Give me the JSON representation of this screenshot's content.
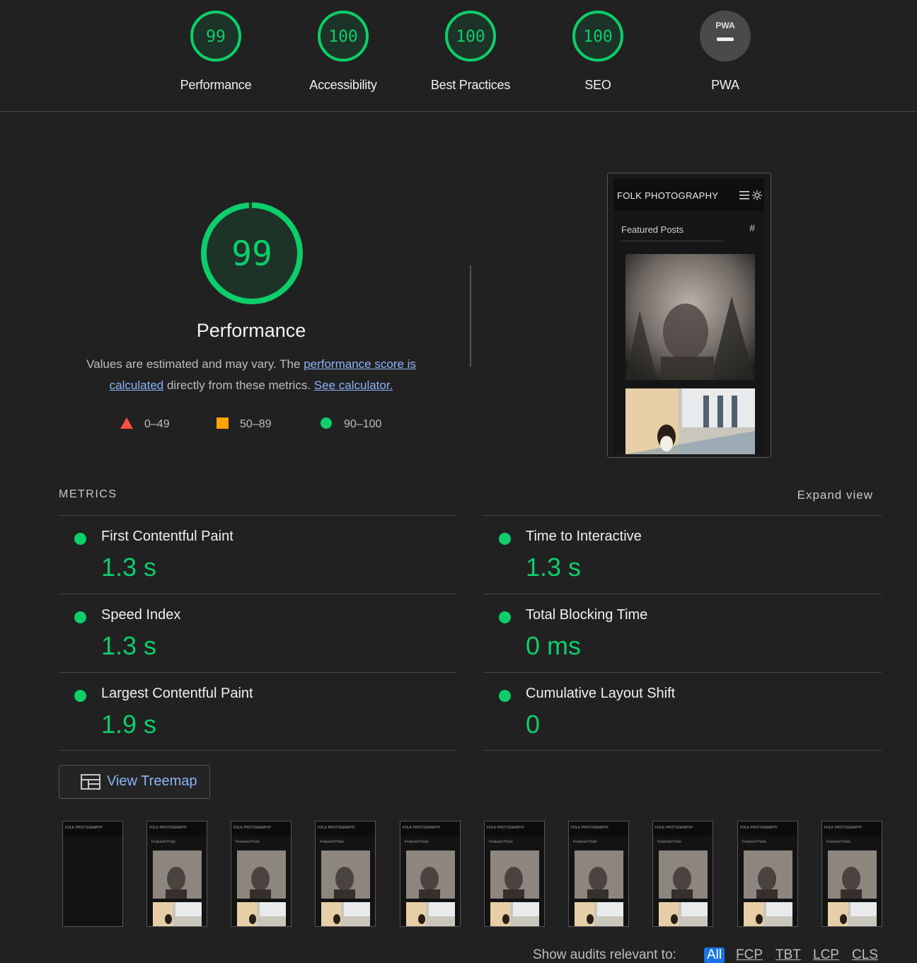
{
  "colors": {
    "pass": "#0cce6b",
    "average": "#ffa400",
    "fail": "#ff4e42",
    "link": "#8ab4f8",
    "background": "#212121"
  },
  "top_gauges": [
    {
      "score": "99",
      "label": "Performance"
    },
    {
      "score": "100",
      "label": "Accessibility"
    },
    {
      "score": "100",
      "label": "Best Practices"
    },
    {
      "score": "100",
      "label": "SEO"
    },
    {
      "score": "",
      "label": "PWA",
      "badge_text": "PWA"
    }
  ],
  "performance": {
    "score": "99",
    "score_fraction": 0.99,
    "title": "Performance",
    "desc_prefix": "Values are estimated and may vary. The ",
    "desc_link1": "performance score is calculated",
    "desc_mid": " directly from these metrics. ",
    "desc_link2": "See calculator."
  },
  "legend": [
    {
      "icon": "triangle-icon",
      "range": "0–49"
    },
    {
      "icon": "square-icon",
      "range": "50–89"
    },
    {
      "icon": "circle-icon",
      "range": "90–100"
    }
  ],
  "screenshot": {
    "brand": "FOLK PHOTOGRAPHY",
    "section": "Featured Posts",
    "hash": "#"
  },
  "metrics": {
    "heading": "METRICS",
    "expand": "Expand view",
    "items": [
      {
        "name": "First Contentful Paint",
        "value": "1.3 s"
      },
      {
        "name": "Time to Interactive",
        "value": "1.3 s"
      },
      {
        "name": "Speed Index",
        "value": "1.3 s"
      },
      {
        "name": "Total Blocking Time",
        "value": "0 ms"
      },
      {
        "name": "Largest Contentful Paint",
        "value": "1.9 s"
      },
      {
        "name": "Cumulative Layout Shift",
        "value": "0"
      }
    ]
  },
  "treemap": {
    "label": "View Treemap"
  },
  "filmstrip": {
    "brand": "FOLK PHOTOGRAPHY",
    "section": "Featured Posts",
    "frames": 10
  },
  "audit_filter": {
    "prefix": "Show audits relevant to:",
    "chips": [
      "All",
      "FCP",
      "TBT",
      "LCP",
      "CLS"
    ]
  }
}
